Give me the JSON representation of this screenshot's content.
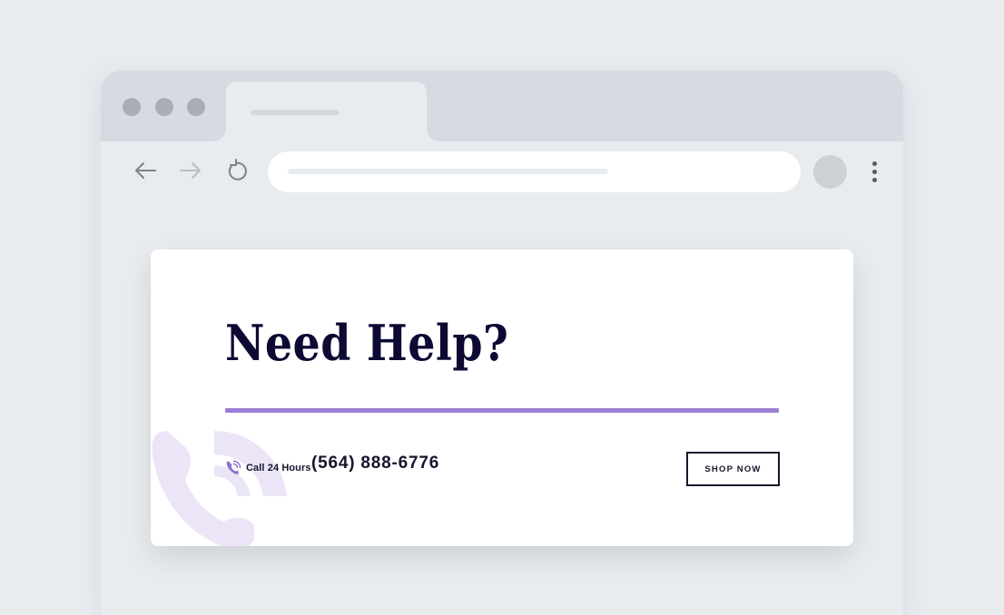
{
  "browser": {
    "window_controls": [
      "close-dot",
      "minimize-dot",
      "maximize-dot"
    ],
    "nav_icons": [
      "back-arrow-icon",
      "forward-arrow-icon",
      "reload-icon"
    ]
  },
  "card": {
    "headline": "Need Help?",
    "call_label": "Call 24 Hours",
    "phone_number": "(564) 888-6776",
    "button_label": "SHOP NOW",
    "accent_color": "#9b7fd6",
    "text_color": "#0c0a33"
  }
}
